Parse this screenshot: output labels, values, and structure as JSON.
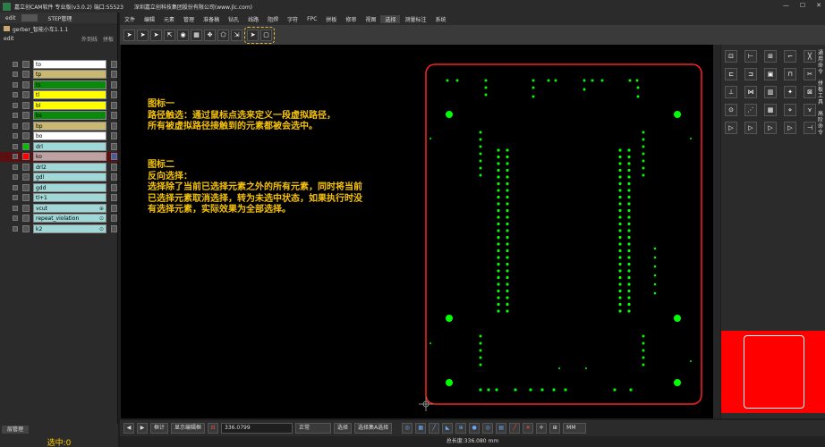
{
  "window": {
    "title": "嘉立创CAM软件 专业版(v3.0.2) 端口:55523",
    "company": "深圳嘉立创科技集团股份有限公司(www.jlc.com)",
    "controls": [
      "—",
      "☐",
      "✕"
    ]
  },
  "left_panel": {
    "tabs": [
      "edit",
      "STEP管理"
    ],
    "project": "gerber_智能小车1.1.1",
    "edit_label": "edit",
    "options": [
      "外到线",
      "拼板"
    ],
    "layers": [
      {
        "name": "to",
        "color": "#ffffff",
        "icon": "",
        "selected": false
      },
      {
        "name": "tp",
        "color": "#c8b870",
        "icon": "",
        "selected": false
      },
      {
        "name": "ts",
        "color": "#0a8a0a",
        "icon": "",
        "selected": false
      },
      {
        "name": "tl",
        "color": "#ffff00",
        "icon": "",
        "selected": false
      },
      {
        "name": "bl",
        "color": "#ffff00",
        "icon": "",
        "selected": false
      },
      {
        "name": "bs",
        "color": "#0a8a0a",
        "icon": "",
        "selected": false
      },
      {
        "name": "bp",
        "color": "#c8b870",
        "icon": "",
        "selected": false
      },
      {
        "name": "bo",
        "color": "#ffffff",
        "icon": "",
        "selected": false
      },
      {
        "name": "drl",
        "color": "#a0d8d8",
        "icon": "",
        "selected": false,
        "swatch": "#00c000"
      },
      {
        "name": "ko",
        "color": "#c0a0a0",
        "icon": "",
        "selected": true,
        "swatch": "#ff0000"
      },
      {
        "name": "drl2",
        "color": "#a0d8d8",
        "icon": "",
        "selected": false
      },
      {
        "name": "gdl",
        "color": "#a0d8d8",
        "icon": "",
        "selected": false
      },
      {
        "name": "gdd",
        "color": "#a0d8d8",
        "icon": "",
        "selected": false
      },
      {
        "name": "tl+1",
        "color": "#a0d8d8",
        "icon": "",
        "selected": false
      },
      {
        "name": "vcut",
        "color": "#a0d8d8",
        "icon": "⊕",
        "selected": false
      },
      {
        "name": "repeat_violation",
        "color": "#a0d8d8",
        "icon": "⊙",
        "selected": false
      },
      {
        "name": "k2",
        "color": "#a0d8d8",
        "icon": "⊙",
        "selected": false
      }
    ],
    "bottom_tab": "层管理",
    "selected_count": "选中:0"
  },
  "menubar": [
    "文件",
    "编辑",
    "元素",
    "管理",
    "准备稿",
    "钻孔",
    "线路",
    "阻焊",
    "字符",
    "FPC",
    "拼板",
    "修审",
    "视图",
    "选择",
    "测量标注",
    "系统"
  ],
  "active_menu": "选择",
  "toolbar_icons": [
    "pointer-icon",
    "pointer-icon",
    "pointer-icon",
    "pointer-box-icon",
    "circle-select-icon",
    "grid-select-icon",
    "move-icon",
    "polygon-select-icon",
    "cursor-box-icon"
  ],
  "toolbar_highlight_icons": [
    "path-select-icon",
    "invert-select-icon"
  ],
  "annotation": {
    "block1": [
      "图标一",
      "路径触选：通过鼠标点选来定义一段虚拟路径，",
      "所有被虚拟路径接触到的元素都被会选中。"
    ],
    "block2": [
      "图标二",
      "反向选择：",
      "选择除了当前已选择元素之外的所有元素，同时将当前",
      "已选择元素取消选择，转为未选中状态，如果执行时没",
      "有选择元素，实际效果为全部选择。"
    ]
  },
  "board": {
    "outline_color": "#ff2020",
    "pad_color": "#00ff00"
  },
  "right_panel": {
    "labels": [
      "通用命令",
      "拼板工具",
      "高阶命令"
    ]
  },
  "bottom_bar": {
    "mode": "框计",
    "show_ref_label": "显示编辑框",
    "coord_value": "336.0799",
    "normal_label": "正常",
    "select_label": "选择",
    "multi_select_label": "选择集A选择",
    "unit": "MM"
  },
  "status": "总长度:336.080 mm"
}
